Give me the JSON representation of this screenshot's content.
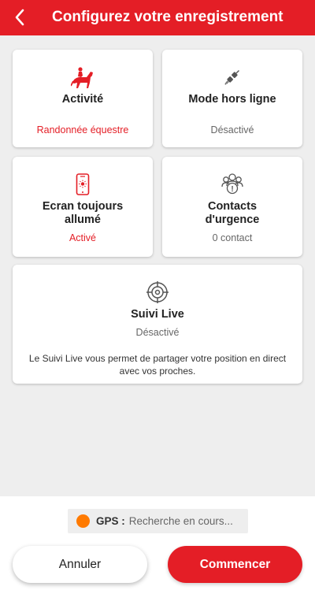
{
  "header": {
    "title": "Configurez votre enregistrement"
  },
  "cards": {
    "activity": {
      "title": "Activité",
      "value": "Randonnée équestre",
      "icon": "horse-rider-icon"
    },
    "offline": {
      "title": "Mode hors ligne",
      "value": "Désactivé",
      "icon": "plug-icon"
    },
    "screen": {
      "title": "Ecran toujours allumé",
      "value": "Activé",
      "icon": "phone-brightness-icon"
    },
    "emergency": {
      "title": "Contacts d'urgence",
      "value": "0 contact",
      "icon": "contacts-group-icon"
    },
    "live": {
      "title": "Suivi Live",
      "value": "Désactivé",
      "description": "Le Suivi Live vous permet de partager votre position en direct avec vos proches.",
      "icon": "target-icon"
    }
  },
  "footer": {
    "gps_label": "GPS :",
    "gps_status": "Recherche en cours...",
    "cancel_label": "Annuler",
    "start_label": "Commencer"
  },
  "colors": {
    "brand_red": "#e41e26",
    "gps_status_dot": "#ff7a00"
  }
}
